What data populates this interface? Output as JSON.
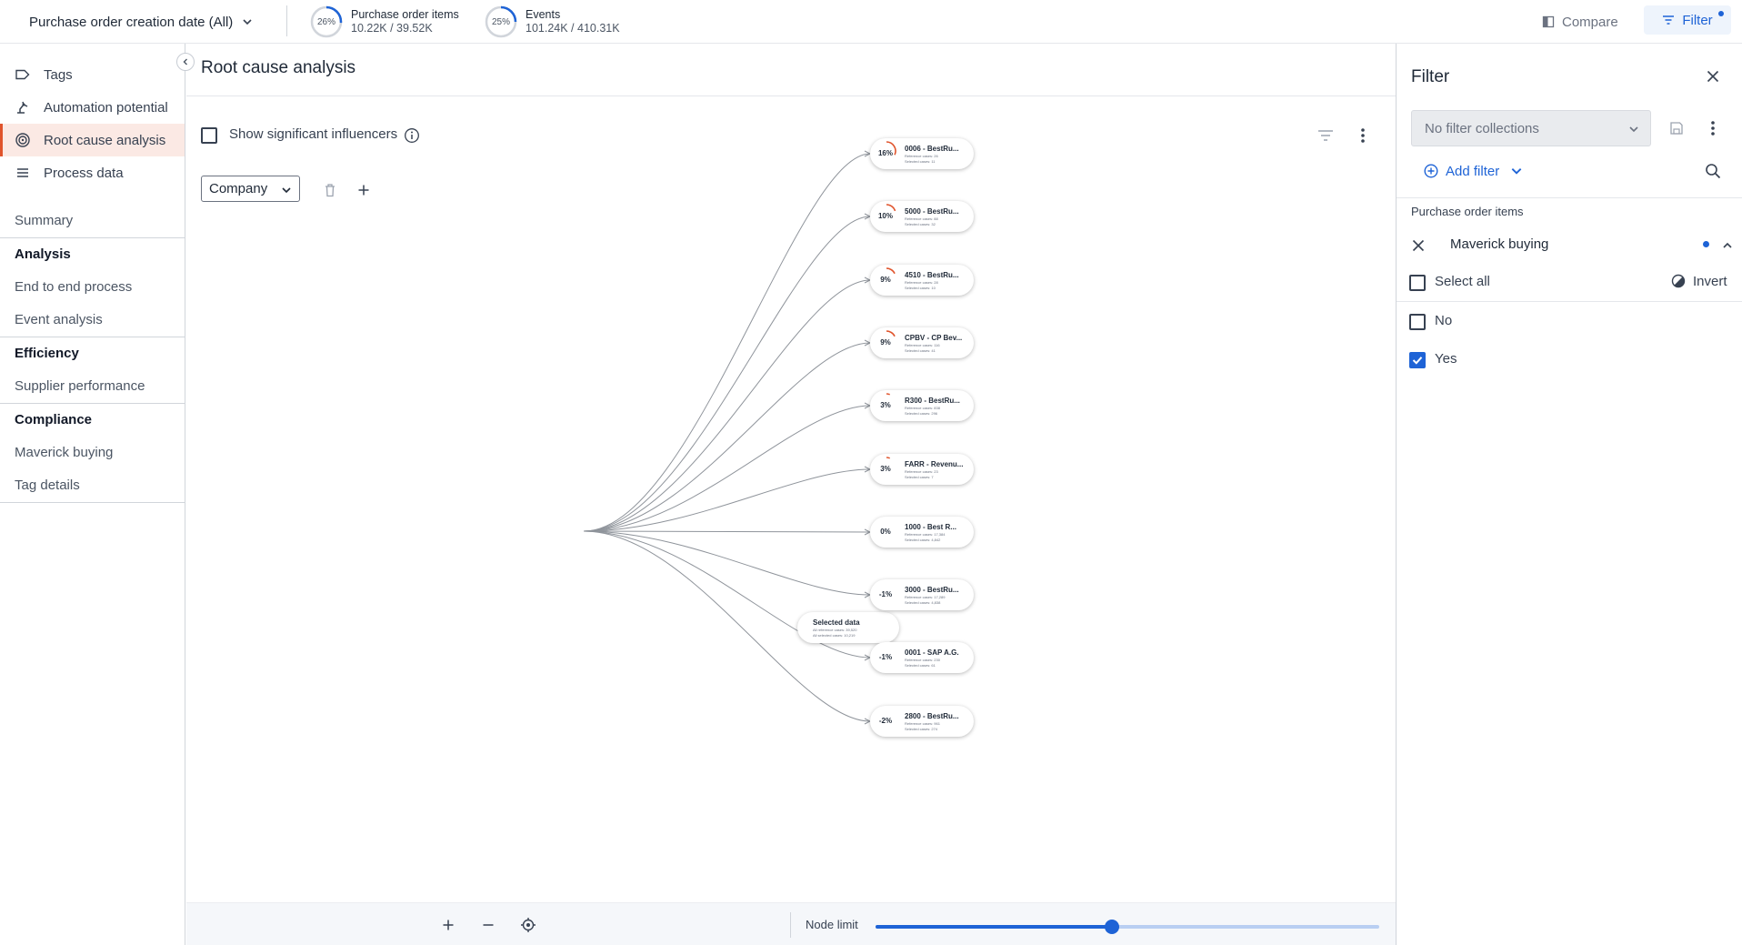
{
  "topbar": {
    "date_filter_label": "Purchase order creation date (All)",
    "kpis": [
      {
        "ring_label": "26%",
        "fill": 0.26,
        "title": "Purchase order items",
        "value": "10.22K / 39.52K"
      },
      {
        "ring_label": "25%",
        "fill": 0.25,
        "title": "Events",
        "value": "101.24K / 410.31K"
      }
    ],
    "compare_label": "Compare",
    "filter_label": "Filter"
  },
  "sidebar": {
    "nav": [
      {
        "label": "Tags",
        "icon": "tag-icon",
        "active": false
      },
      {
        "label": "Automation potential",
        "icon": "robot-arm-icon",
        "active": false
      },
      {
        "label": "Root cause analysis",
        "icon": "target-icon",
        "active": true
      },
      {
        "label": "Process data",
        "icon": "list-icon",
        "active": false
      }
    ],
    "summary": "Summary",
    "sections": [
      {
        "heading": "Analysis",
        "links": [
          "End to end process",
          "Event analysis"
        ]
      },
      {
        "heading": "Efficiency",
        "links": [
          "Supplier performance"
        ]
      },
      {
        "heading": "Compliance",
        "links": [
          "Maverick buying",
          "Tag details"
        ]
      }
    ]
  },
  "main": {
    "title": "Root cause analysis",
    "show_influencers_label": "Show significant influencers",
    "attribute_select": "Company",
    "node_limit_label": "Node limit",
    "node_limit_fraction": 0.47
  },
  "graph": {
    "root": {
      "name": "Selected data",
      "line1": "All reference cases: 39,520",
      "line2": "All selected cases: 10,219"
    },
    "nodes": [
      {
        "pct": "16%",
        "value": 16,
        "name": "0006 - BestRu...",
        "line1": "Reference cases: 26",
        "line2": "Selected cases: 11"
      },
      {
        "pct": "10%",
        "value": 10,
        "name": "5000 - BestRu...",
        "line1": "Reference cases: 88",
        "line2": "Selected cases: 32"
      },
      {
        "pct": "9%",
        "value": 9,
        "name": "4510 - BestRu...",
        "line1": "Reference cases: 28",
        "line2": "Selected cases: 10"
      },
      {
        "pct": "9%",
        "value": 9,
        "name": "CPBV - CP Bev...",
        "line1": "Reference cases: 116",
        "line2": "Selected cases: 41"
      },
      {
        "pct": "3%",
        "value": 3,
        "name": "R300 - BestRu...",
        "line1": "Reference cases: 838",
        "line2": "Selected cases: 296"
      },
      {
        "pct": "3%",
        "value": 3,
        "name": "FARR - Revenu...",
        "line1": "Reference cases: 23",
        "line2": "Selected cases: 7"
      },
      {
        "pct": "0%",
        "value": 0,
        "name": "1000 - Best R...",
        "line1": "Reference cases: 17,384",
        "line2": "Selected cases: 4,842"
      },
      {
        "pct": "-1%",
        "value": -1,
        "name": "3000 - BestRu...",
        "line1": "Reference cases: 17,289",
        "line2": "Selected cases: 4,838"
      },
      {
        "pct": "-1%",
        "value": -1,
        "name": "0001 - SAP A.G.",
        "line1": "Reference cases: 230",
        "line2": "Selected cases: 61"
      },
      {
        "pct": "-2%",
        "value": -2,
        "name": "2800 - BestRu...",
        "line1": "Reference cases: 961",
        "line2": "Selected cases: 274"
      }
    ]
  },
  "filter_panel": {
    "title": "Filter",
    "collections_placeholder": "No filter collections",
    "add_filter_label": "Add filter",
    "group_label": "Purchase order items",
    "field_label": "Maverick buying",
    "select_all_label": "Select all",
    "invert_label": "Invert",
    "options": [
      {
        "label": "No",
        "checked": false
      },
      {
        "label": "Yes",
        "checked": true
      }
    ]
  },
  "colors": {
    "accent": "#1e63d6",
    "active_nav": "#e0542c",
    "arc": "#e0542c"
  }
}
